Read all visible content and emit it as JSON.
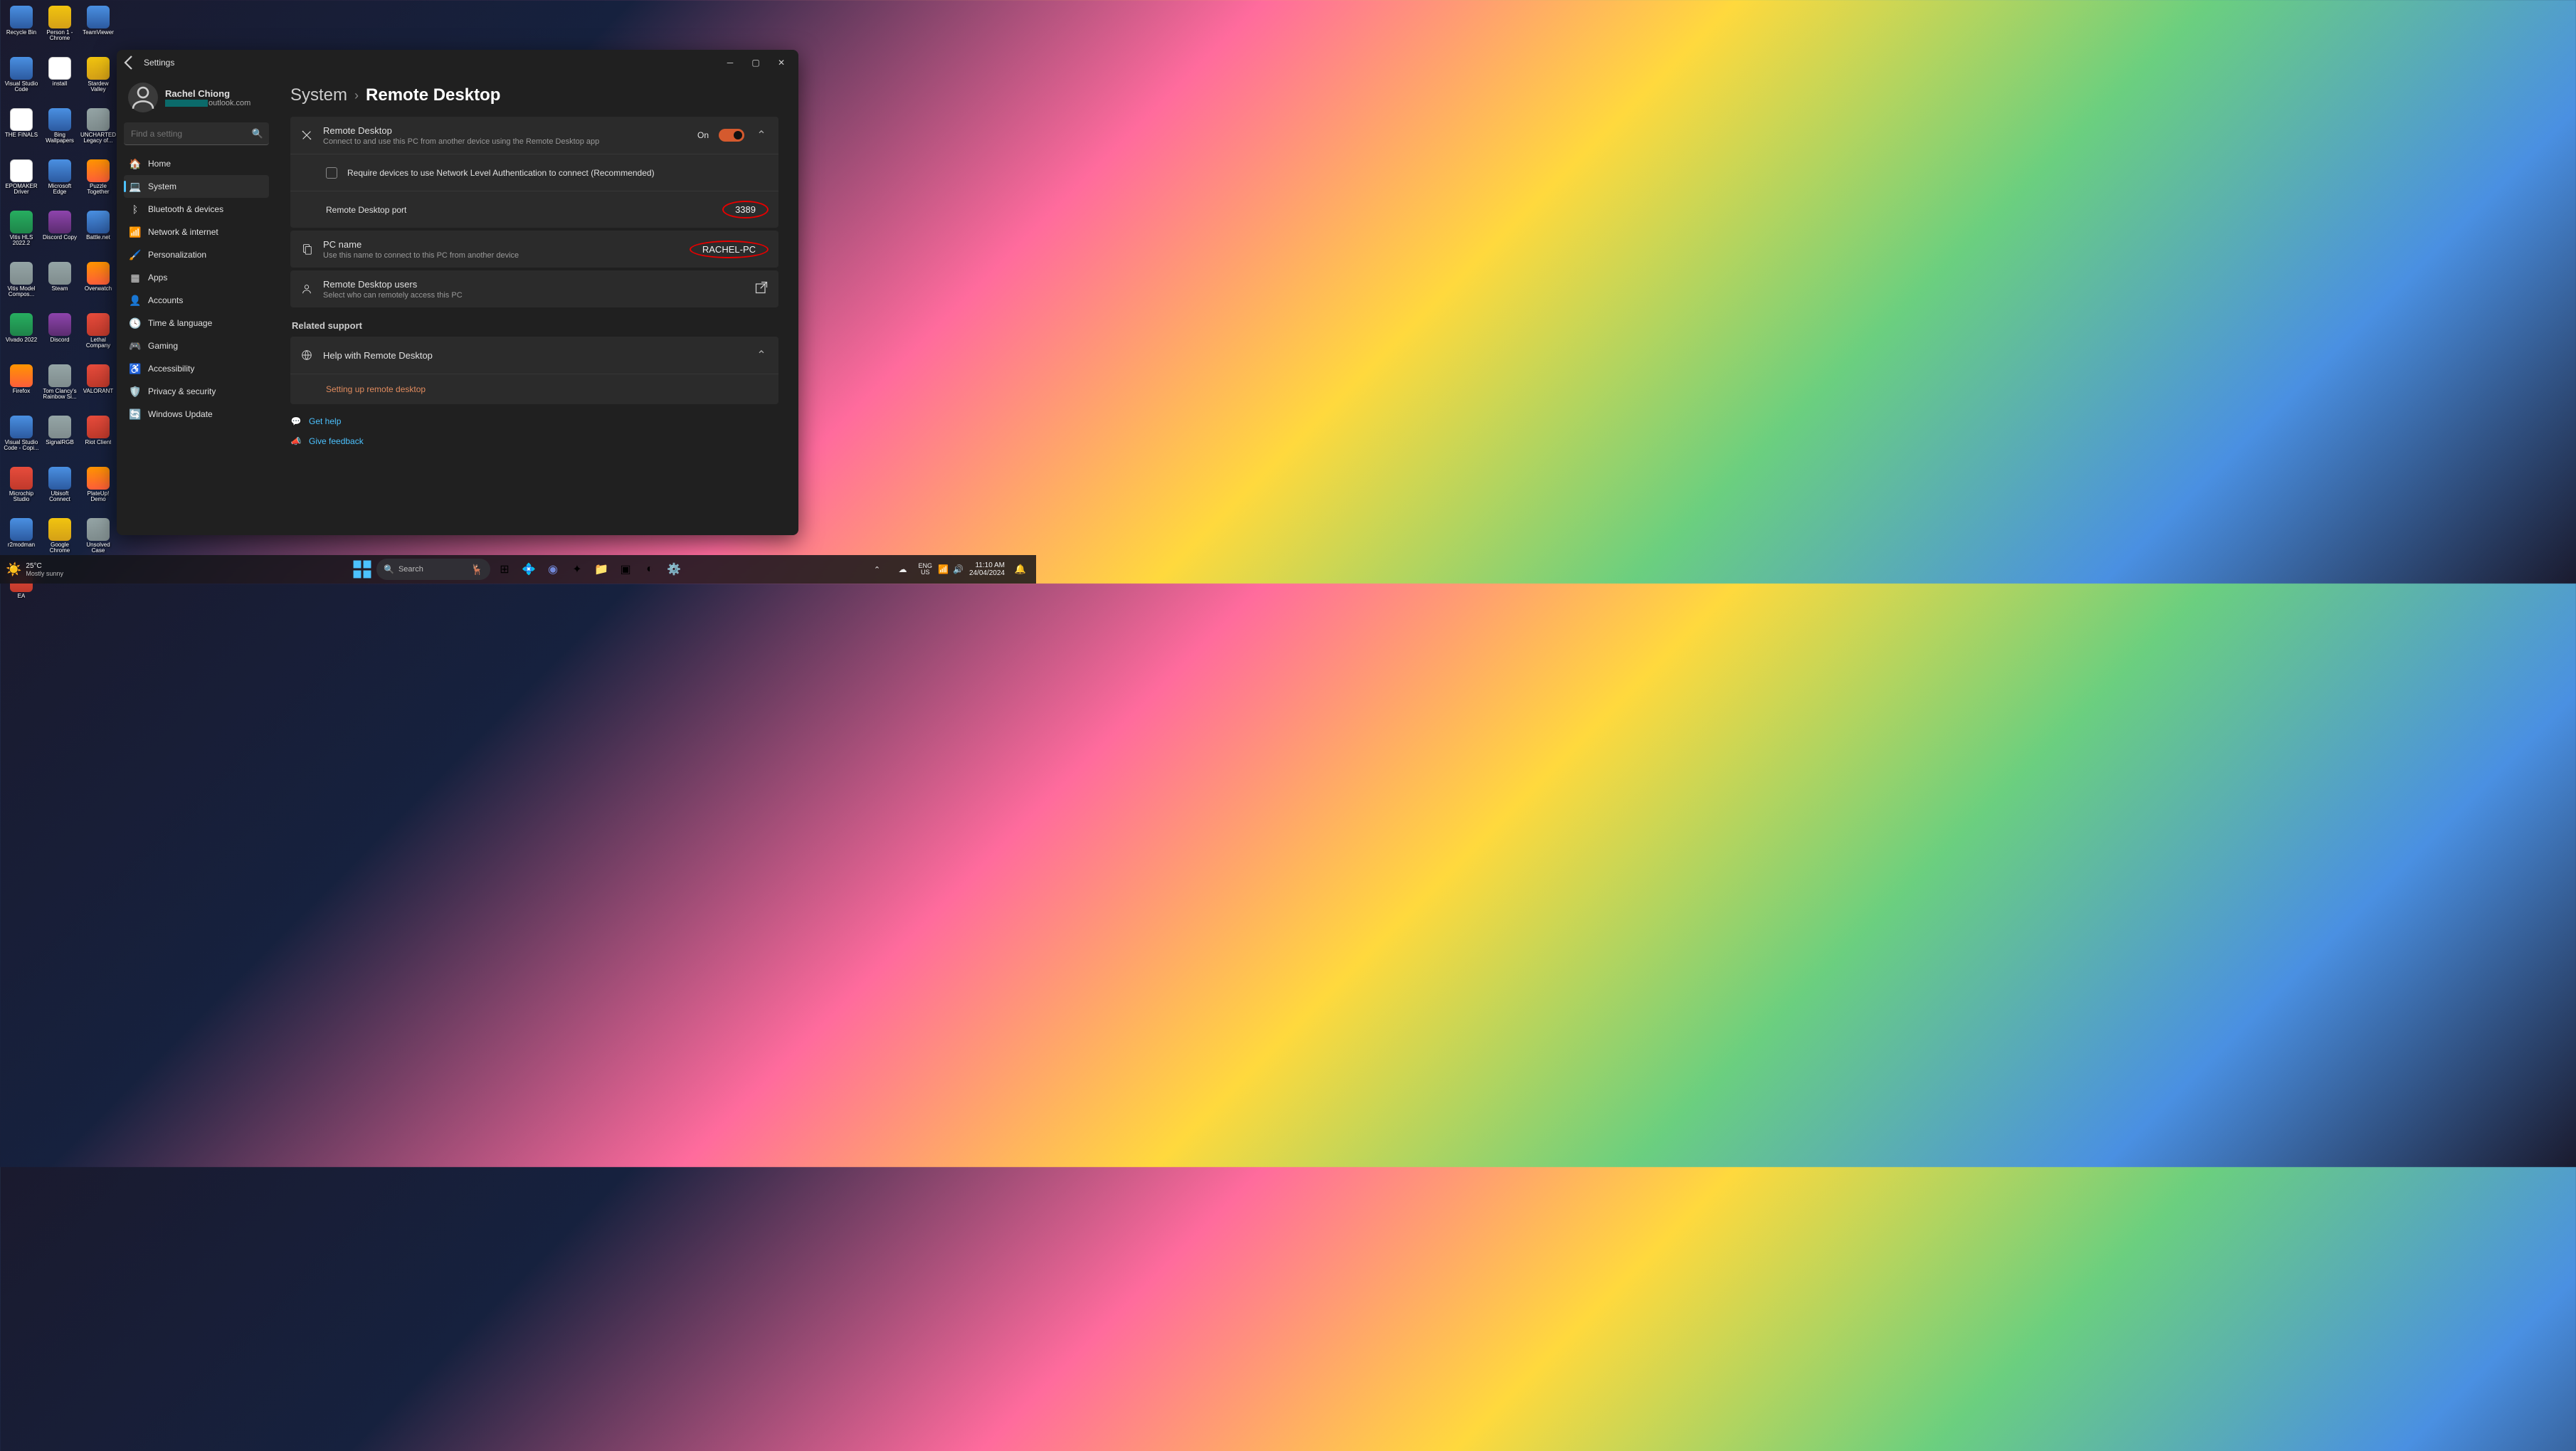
{
  "desktop_icons": [
    {
      "label": "Recycle Bin",
      "cls": "blue"
    },
    {
      "label": "Person 1 - Chrome",
      "cls": "yellow"
    },
    {
      "label": "TeamViewer",
      "cls": "blue"
    },
    {
      "label": "Visual Studio Code",
      "cls": "blue"
    },
    {
      "label": "install",
      "cls": "white"
    },
    {
      "label": "Stardew Valley",
      "cls": "yellow"
    },
    {
      "label": "THE FINALS",
      "cls": "white"
    },
    {
      "label": "Bing Wallpapers",
      "cls": "blue"
    },
    {
      "label": "UNCHARTED Legacy of...",
      "cls": "grey"
    },
    {
      "label": "EPOMAKER Driver",
      "cls": "white"
    },
    {
      "label": "Microsoft Edge",
      "cls": "blue"
    },
    {
      "label": "Puzzle Together",
      "cls": "orange"
    },
    {
      "label": "Vitis HLS 2022.2",
      "cls": "green"
    },
    {
      "label": "Discord Copy",
      "cls": "purple"
    },
    {
      "label": "Battle.net",
      "cls": "blue"
    },
    {
      "label": "Vitis Model Compos...",
      "cls": "grey"
    },
    {
      "label": "Steam",
      "cls": "grey"
    },
    {
      "label": "Overwatch",
      "cls": "orange"
    },
    {
      "label": "Vivado 2022",
      "cls": "green"
    },
    {
      "label": "Discord",
      "cls": "purple"
    },
    {
      "label": "Lethal Company",
      "cls": "red"
    },
    {
      "label": "Firefox",
      "cls": "orange"
    },
    {
      "label": "Tom Clancy's Rainbow Si...",
      "cls": "grey"
    },
    {
      "label": "VALORANT",
      "cls": "red"
    },
    {
      "label": "Visual Studio Code - Copi...",
      "cls": "blue"
    },
    {
      "label": "SignalRGB",
      "cls": "grey"
    },
    {
      "label": "Riot Client",
      "cls": "red"
    },
    {
      "label": "Microchip Studio",
      "cls": "red"
    },
    {
      "label": "Ubisoft Connect",
      "cls": "blue"
    },
    {
      "label": "PlateUp! Demo",
      "cls": "orange"
    },
    {
      "label": "r2modman",
      "cls": "blue"
    },
    {
      "label": "Google Chrome",
      "cls": "yellow"
    },
    {
      "label": "Unsolved Case",
      "cls": "grey"
    },
    {
      "label": "EA",
      "cls": "red"
    }
  ],
  "window": {
    "title": "Settings",
    "user": {
      "name": "Rachel Chiong",
      "email_suffix": "outlook.com"
    },
    "search_placeholder": "Find a setting",
    "nav": [
      {
        "icon": "🏠",
        "label": "Home"
      },
      {
        "icon": "💻",
        "label": "System"
      },
      {
        "icon": "ᛒ",
        "label": "Bluetooth & devices"
      },
      {
        "icon": "📶",
        "label": "Network & internet"
      },
      {
        "icon": "🖌️",
        "label": "Personalization"
      },
      {
        "icon": "▦",
        "label": "Apps"
      },
      {
        "icon": "👤",
        "label": "Accounts"
      },
      {
        "icon": "🕓",
        "label": "Time & language"
      },
      {
        "icon": "🎮",
        "label": "Gaming"
      },
      {
        "icon": "♿",
        "label": "Accessibility"
      },
      {
        "icon": "🛡️",
        "label": "Privacy & security"
      },
      {
        "icon": "🔄",
        "label": "Windows Update"
      }
    ],
    "breadcrumb": {
      "root": "System",
      "page": "Remote Desktop"
    },
    "rd": {
      "title": "Remote Desktop",
      "sub": "Connect to and use this PC from another device using the Remote Desktop app",
      "state": "On",
      "nla_label": "Require devices to use Network Level Authentication to connect (Recommended)",
      "port_label": "Remote Desktop port",
      "port_value": "3389",
      "pcname_title": "PC name",
      "pcname_sub": "Use this name to connect to this PC from another device",
      "pcname_value": "RACHEL-PC",
      "users_title": "Remote Desktop users",
      "users_sub": "Select who can remotely access this PC"
    },
    "related_header": "Related support",
    "help_title": "Help with Remote Desktop",
    "help_link": "Setting up remote desktop",
    "get_help": "Get help",
    "feedback": "Give feedback"
  },
  "taskbar": {
    "weather_temp": "25°C",
    "weather_desc": "Mostly sunny",
    "search": "Search",
    "lang1": "ENG",
    "lang2": "US",
    "time": "11:10 AM",
    "date": "24/04/2024"
  }
}
